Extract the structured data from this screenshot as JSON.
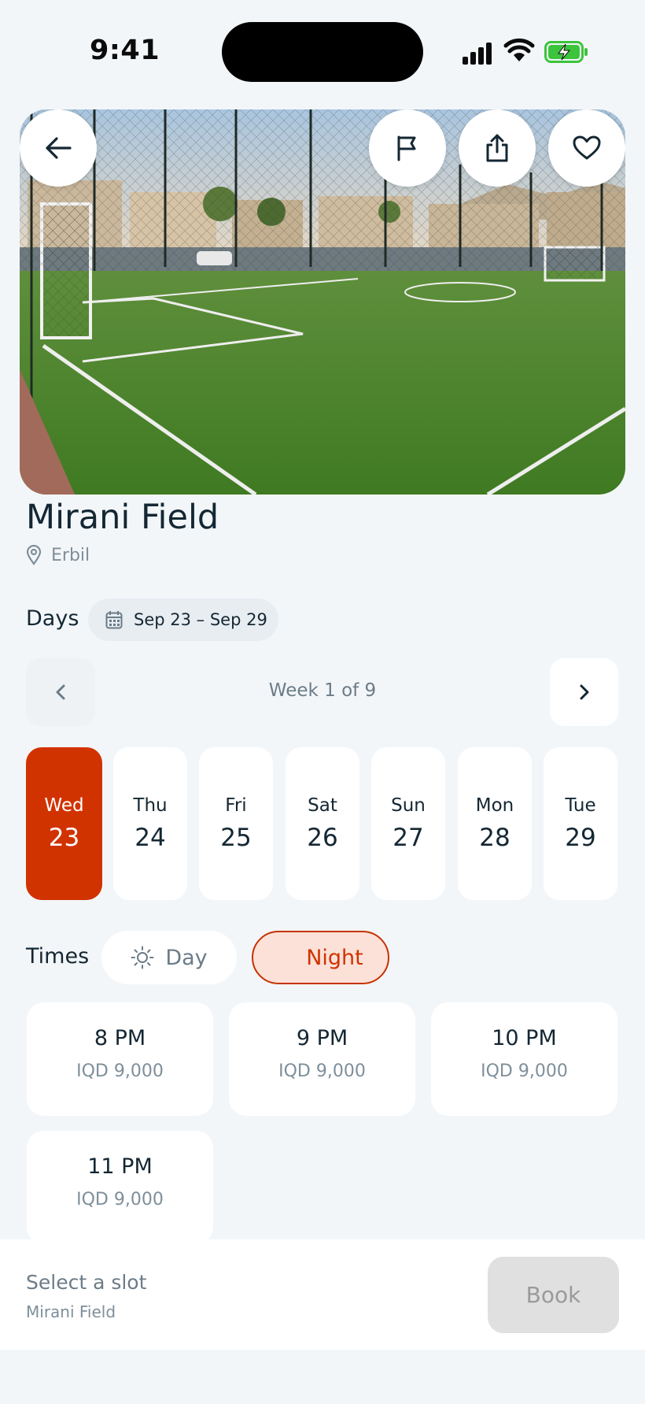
{
  "status_bar": {
    "time": "9:41"
  },
  "header_actions": {
    "back_icon": "arrow-left-icon",
    "flag_icon": "flag-icon",
    "share_icon": "share-icon",
    "favorite_icon": "heart-icon"
  },
  "venue": {
    "name": "Mirani Field",
    "city": "Erbil"
  },
  "days": {
    "label": "Days",
    "range": "Sep 23 – Sep 29",
    "week_label": "Week 1 of 9",
    "items": [
      {
        "day": "Wed",
        "date": "23",
        "selected": true
      },
      {
        "day": "Thu",
        "date": "24",
        "selected": false
      },
      {
        "day": "Fri",
        "date": "25",
        "selected": false
      },
      {
        "day": "Sat",
        "date": "26",
        "selected": false
      },
      {
        "day": "Sun",
        "date": "27",
        "selected": false
      },
      {
        "day": "Mon",
        "date": "28",
        "selected": false
      },
      {
        "day": "Tue",
        "date": "29",
        "selected": false
      }
    ]
  },
  "times": {
    "label": "Times",
    "toggle_day": "Day",
    "toggle_night": "Night",
    "active_toggle": "Night",
    "slots": [
      {
        "time": "8 PM",
        "price": "IQD 9,000"
      },
      {
        "time": "9 PM",
        "price": "IQD 9,000"
      },
      {
        "time": "10 PM",
        "price": "IQD 9,000"
      },
      {
        "time": "11 PM",
        "price": "IQD 9,000"
      }
    ]
  },
  "footer": {
    "title": "Select a slot",
    "subtitle": "Mirani Field",
    "book_label": "Book"
  },
  "colors": {
    "accent": "#d13300",
    "accent_bg": "#fbe1d8",
    "background": "#f3f6f9",
    "text": "#142733",
    "muted": "#7e8f9a"
  }
}
